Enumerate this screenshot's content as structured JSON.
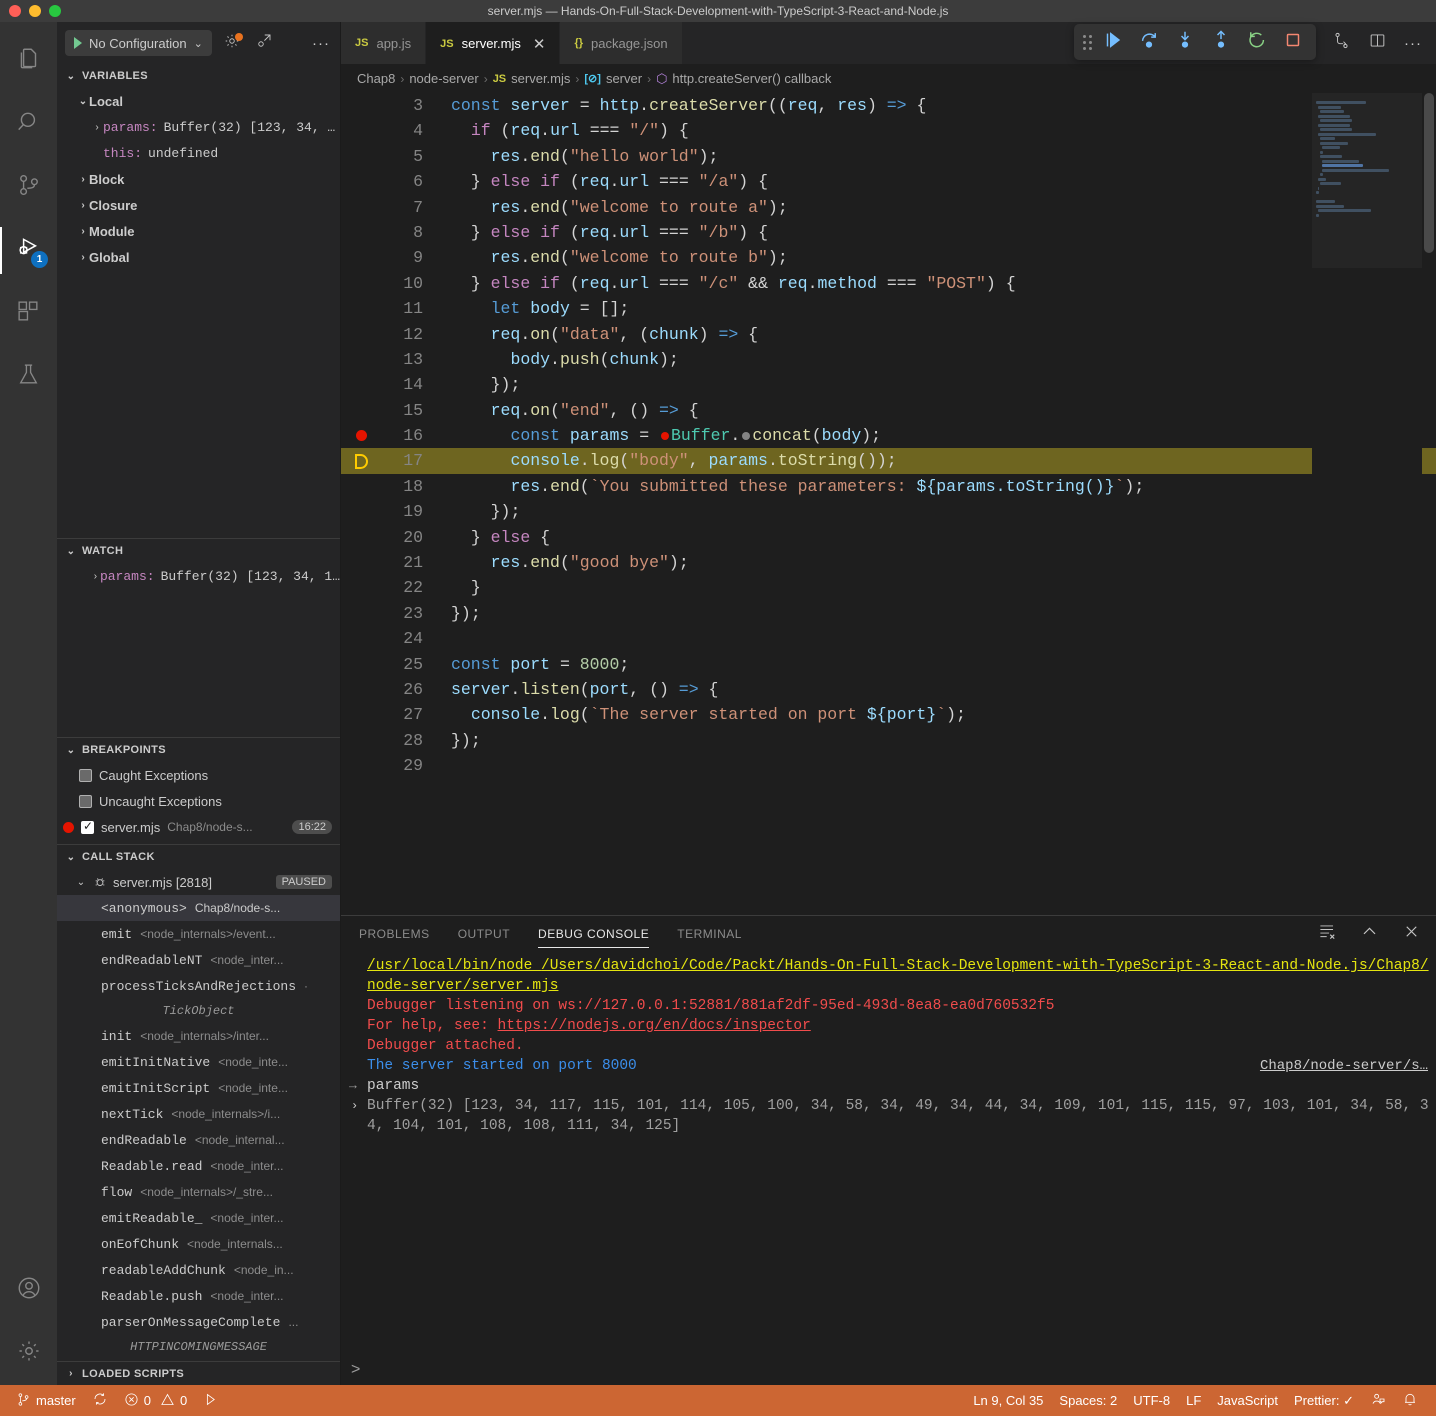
{
  "window": {
    "title": "server.mjs — Hands-On-Full-Stack-Development-with-TypeScript-3-React-and-Node.js"
  },
  "activity_bar": {
    "items": [
      {
        "name": "explorer",
        "icon": "files-icon"
      },
      {
        "name": "search",
        "icon": "search-icon"
      },
      {
        "name": "source-control",
        "icon": "source-control-icon"
      },
      {
        "name": "run-and-debug",
        "icon": "debug-icon",
        "badge": "1",
        "active": true
      },
      {
        "name": "extensions",
        "icon": "extensions-icon"
      },
      {
        "name": "testing",
        "icon": "beaker-icon"
      }
    ],
    "bottom": [
      {
        "name": "accounts",
        "icon": "account-icon"
      },
      {
        "name": "manage",
        "icon": "gear-icon"
      }
    ]
  },
  "debug_sidebar": {
    "config_label": "No Configuration",
    "toolbar_icons": [
      "gear-icon",
      "open-debug-console-icon",
      "more-actions-icon"
    ],
    "variables": {
      "title": "VARIABLES",
      "scopes": [
        {
          "label": "Local",
          "expanded": true,
          "rows": [
            {
              "name": "params:",
              "value": "Buffer(32) [123, 34, …",
              "expandable": true
            },
            {
              "name": "this:",
              "value": "undefined",
              "expandable": false
            }
          ]
        },
        {
          "label": "Block",
          "expanded": false,
          "rows": []
        },
        {
          "label": "Closure",
          "expanded": false,
          "rows": []
        },
        {
          "label": "Module",
          "expanded": false,
          "rows": []
        },
        {
          "label": "Global",
          "expanded": false,
          "rows": []
        }
      ]
    },
    "watch": {
      "title": "WATCH",
      "rows": [
        {
          "name": "params:",
          "value": "Buffer(32) [123, 34, 1…"
        }
      ]
    },
    "breakpoints": {
      "title": "BREAKPOINTS",
      "items": [
        {
          "label": "Caught Exceptions",
          "checked": false,
          "kind": "exception"
        },
        {
          "label": "Uncaught Exceptions",
          "checked": false,
          "kind": "exception"
        },
        {
          "label": "server.mjs",
          "sub": "Chap8/node-s...",
          "line": "16:22",
          "checked": true,
          "kind": "source"
        }
      ]
    },
    "call_stack": {
      "title": "CALL STACK",
      "thread": {
        "label": "server.mjs [2818]",
        "state": "PAUSED"
      },
      "frames": [
        {
          "fn": "<anonymous>",
          "src": "Chap8/node-s...",
          "selected": true
        },
        {
          "fn": "emit",
          "src": "<node_internals>/event..."
        },
        {
          "fn": "endReadableNT",
          "src": "<node_inter..."
        },
        {
          "fn": "processTicksAndRejections",
          "src": "·",
          "sub": "TickObject"
        },
        {
          "fn": "init",
          "src": "<node_internals>/inter..."
        },
        {
          "fn": "emitInitNative",
          "src": "<node_inte..."
        },
        {
          "fn": "emitInitScript",
          "src": "<node_inte..."
        },
        {
          "fn": "nextTick",
          "src": "<node_internals>/i..."
        },
        {
          "fn": "endReadable",
          "src": "<node_internal..."
        },
        {
          "fn": "Readable.read",
          "src": "<node_inter..."
        },
        {
          "fn": "flow",
          "src": "<node_internals>/_stre..."
        },
        {
          "fn": "emitReadable_",
          "src": "<node_inter..."
        },
        {
          "fn": "onEofChunk",
          "src": "<node_internals..."
        },
        {
          "fn": "readableAddChunk",
          "src": "<node_in..."
        },
        {
          "fn": "Readable.push",
          "src": "<node_inter..."
        },
        {
          "fn": "parserOnMessageComplete",
          "src": "...",
          "sub": "HTTPINCOMINGMESSAGE"
        }
      ]
    },
    "loaded_scripts": {
      "title": "LOADED SCRIPTS",
      "expanded": false
    }
  },
  "tabs": [
    {
      "label": "app.js",
      "icon": "js-icon",
      "active": false,
      "closable": false
    },
    {
      "label": "server.mjs",
      "icon": "js-icon",
      "active": true,
      "closable": true
    },
    {
      "label": "package.json",
      "icon": "json-icon",
      "active": false,
      "closable": false
    }
  ],
  "debug_toolbar": {
    "buttons": [
      {
        "name": "continue",
        "icon": "continue-icon",
        "color": "#75beff"
      },
      {
        "name": "step-over",
        "icon": "step-over-icon",
        "color": "#75beff"
      },
      {
        "name": "step-into",
        "icon": "step-into-icon",
        "color": "#75beff"
      },
      {
        "name": "step-out",
        "icon": "step-out-icon",
        "color": "#75beff"
      },
      {
        "name": "restart",
        "icon": "restart-icon",
        "color": "#89d185"
      },
      {
        "name": "stop",
        "icon": "stop-icon",
        "color": "#f48771"
      }
    ]
  },
  "editor_actions": [
    {
      "name": "split-editor-down",
      "icon": "source-control-icon"
    },
    {
      "name": "split-editor",
      "icon": "split-editor-icon"
    },
    {
      "name": "more-actions",
      "icon": "more-actions-icon"
    }
  ],
  "breadcrumb": [
    {
      "label": "Chap8",
      "icon": null
    },
    {
      "label": "node-server",
      "icon": null
    },
    {
      "label": "server.mjs",
      "icon": "js-icon"
    },
    {
      "label": "server",
      "icon": "variable-icon"
    },
    {
      "label": "http.createServer() callback",
      "icon": "function-icon"
    }
  ],
  "editor": {
    "language": "JavaScript",
    "first_visible_line": 3,
    "current_line": 17,
    "breakpoint_line": 16,
    "lines": [
      {
        "n": 3,
        "text": "const server = http.createServer((req, res) => {"
      },
      {
        "n": 4,
        "text": "  if (req.url === \"/\") {"
      },
      {
        "n": 5,
        "text": "    res.end(\"hello world\");"
      },
      {
        "n": 6,
        "text": "  } else if (req.url === \"/a\") {"
      },
      {
        "n": 7,
        "text": "    res.end(\"welcome to route a\");"
      },
      {
        "n": 8,
        "text": "  } else if (req.url === \"/b\") {"
      },
      {
        "n": 9,
        "text": "    res.end(\"welcome to route b\");"
      },
      {
        "n": 10,
        "text": "  } else if (req.url === \"/c\" && req.method === \"POST\") {"
      },
      {
        "n": 11,
        "text": "    let body = [];"
      },
      {
        "n": 12,
        "text": "    req.on(\"data\", (chunk) => {"
      },
      {
        "n": 13,
        "text": "      body.push(chunk);"
      },
      {
        "n": 14,
        "text": "    });"
      },
      {
        "n": 15,
        "text": "    req.on(\"end\", () => {"
      },
      {
        "n": 16,
        "text": "      const params = Buffer.concat(body);"
      },
      {
        "n": 17,
        "text": "      console.log(\"body\", params.toString());"
      },
      {
        "n": 18,
        "text": "      res.end(`You submitted these parameters: ${params.toString()}`);"
      },
      {
        "n": 19,
        "text": "    });"
      },
      {
        "n": 20,
        "text": "  } else {"
      },
      {
        "n": 21,
        "text": "    res.end(\"good bye\");"
      },
      {
        "n": 22,
        "text": "  }"
      },
      {
        "n": 23,
        "text": "});"
      },
      {
        "n": 24,
        "text": ""
      },
      {
        "n": 25,
        "text": "const port = 8000;"
      },
      {
        "n": 26,
        "text": "server.listen(port, () => {"
      },
      {
        "n": 27,
        "text": "  console.log(`The server started on port ${port}`);"
      },
      {
        "n": 28,
        "text": "});"
      },
      {
        "n": 29,
        "text": ""
      }
    ]
  },
  "panel": {
    "tabs": [
      {
        "label": "PROBLEMS",
        "active": false
      },
      {
        "label": "OUTPUT",
        "active": false
      },
      {
        "label": "DEBUG CONSOLE",
        "active": true
      },
      {
        "label": "TERMINAL",
        "active": false
      }
    ],
    "actions": [
      {
        "name": "clear-console",
        "icon": "clear-icon"
      },
      {
        "name": "maximize-panel",
        "icon": "chevron-up-icon"
      },
      {
        "name": "close-panel",
        "icon": "close-icon"
      }
    ],
    "console_lines": [
      {
        "kind": "cmd_path",
        "a": "/usr/local/bin/node ",
        "b": "/Users/davidchoi/Code/Packt/Hands-On-Full-Stack-Development-with-TypeScript-3-React-and-Node.js/Chap8/node-server/server.mjs"
      },
      {
        "kind": "red",
        "text": "Debugger listening on ws://127.0.0.1:52881/881af2df-95ed-493d-8ea8-ea0d760532f5"
      },
      {
        "kind": "red_link",
        "text": "For help, see: ",
        "link": "https://nodejs.org/en/docs/inspector"
      },
      {
        "kind": "red",
        "text": "Debugger attached."
      },
      {
        "kind": "blue",
        "text": "The server started on port 8000",
        "source": "Chap8/node-server/s…"
      },
      {
        "kind": "input_echo",
        "text": "params"
      },
      {
        "kind": "value",
        "text": "Buffer(32) [123, 34, 117, 115, 101, 114, 105, 100, 34, 58, 34, 49, 34, 44, 34, 109, 101, 115, 115, 97, 103, 101, 34, 58, 34, 104, 101, 108, 108, 111, 34, 125]"
      }
    ],
    "prompt": ">"
  },
  "status_bar": {
    "left": [
      {
        "name": "branch",
        "icon": "git-branch-icon",
        "label": "master"
      },
      {
        "name": "sync",
        "icon": "sync-icon",
        "label": ""
      },
      {
        "name": "problems",
        "icon": "error-warning-icon",
        "label": "0",
        "label2": "0"
      },
      {
        "name": "run",
        "icon": "play-icon",
        "label": ""
      }
    ],
    "right": [
      {
        "name": "cursor-position",
        "label": "Ln 9, Col 35"
      },
      {
        "name": "indentation",
        "label": "Spaces: 2"
      },
      {
        "name": "encoding",
        "label": "UTF-8"
      },
      {
        "name": "eol",
        "label": "LF"
      },
      {
        "name": "language-mode",
        "label": "JavaScript"
      },
      {
        "name": "prettier",
        "label": "Prettier: ✓"
      },
      {
        "name": "feedback",
        "icon": "feedback-icon",
        "label": ""
      },
      {
        "name": "notifications",
        "icon": "bell-icon",
        "label": ""
      }
    ]
  },
  "colors": {
    "status_bar_bg": "#cc6633",
    "accent_blue": "#0e70c0",
    "breakpoint_red": "#e51400",
    "current_line_highlight": "#6e6520",
    "editor_bg": "#1e1e1e",
    "sidebar_bg": "#252526"
  }
}
